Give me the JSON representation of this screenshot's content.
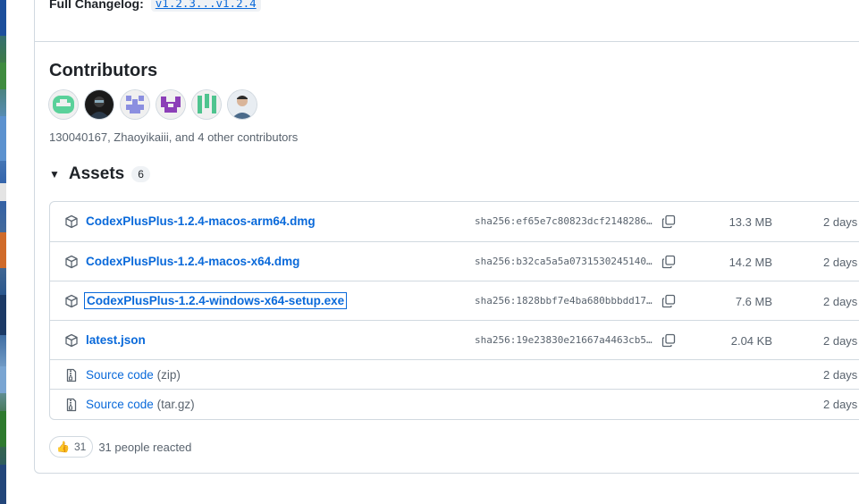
{
  "changelog": {
    "label": "Full Changelog:",
    "link": "v1.2.3...v1.2.4"
  },
  "contributors": {
    "title": "Contributors",
    "avatars": [
      "130040167",
      "Zhaoyikaiii",
      "contributor-3",
      "contributor-4",
      "contributor-5",
      "contributor-6"
    ],
    "summary": "130040167, Zhaoyikaiii, and 4 other contributors"
  },
  "assets": {
    "caret": "▼",
    "title": "Assets",
    "count": "6",
    "rows": [
      {
        "name": "CodexPlusPlus-1.2.4-macos-arm64.dmg",
        "sha": "sha256:ef65e7c80823dcf2148286…",
        "size": "13.3 MB",
        "date": "2 days"
      },
      {
        "name": "CodexPlusPlus-1.2.4-macos-x64.dmg",
        "sha": "sha256:b32ca5a5a0731530245140…",
        "size": "14.2 MB",
        "date": "2 days"
      },
      {
        "name": "CodexPlusPlus-1.2.4-windows-x64-setup.exe",
        "sha": "sha256:1828bbf7e4ba680bbbdd17…",
        "size": "7.6 MB",
        "date": "2 days"
      },
      {
        "name": "latest.json",
        "sha": "sha256:19e23830e21667a4463cb5…",
        "size": "2.04 KB",
        "date": "2 days"
      }
    ],
    "source": [
      {
        "name": "Source code",
        "suffix": "(zip)",
        "date": "2 days"
      },
      {
        "name": "Source code",
        "suffix": "(tar.gz)",
        "date": "2 days"
      }
    ]
  },
  "reactions": {
    "emoji": "👍",
    "count": "31",
    "text": "31 people reacted"
  },
  "colors": {
    "link": "#0969da",
    "border": "#d1d9e0",
    "muted": "#59636e"
  }
}
